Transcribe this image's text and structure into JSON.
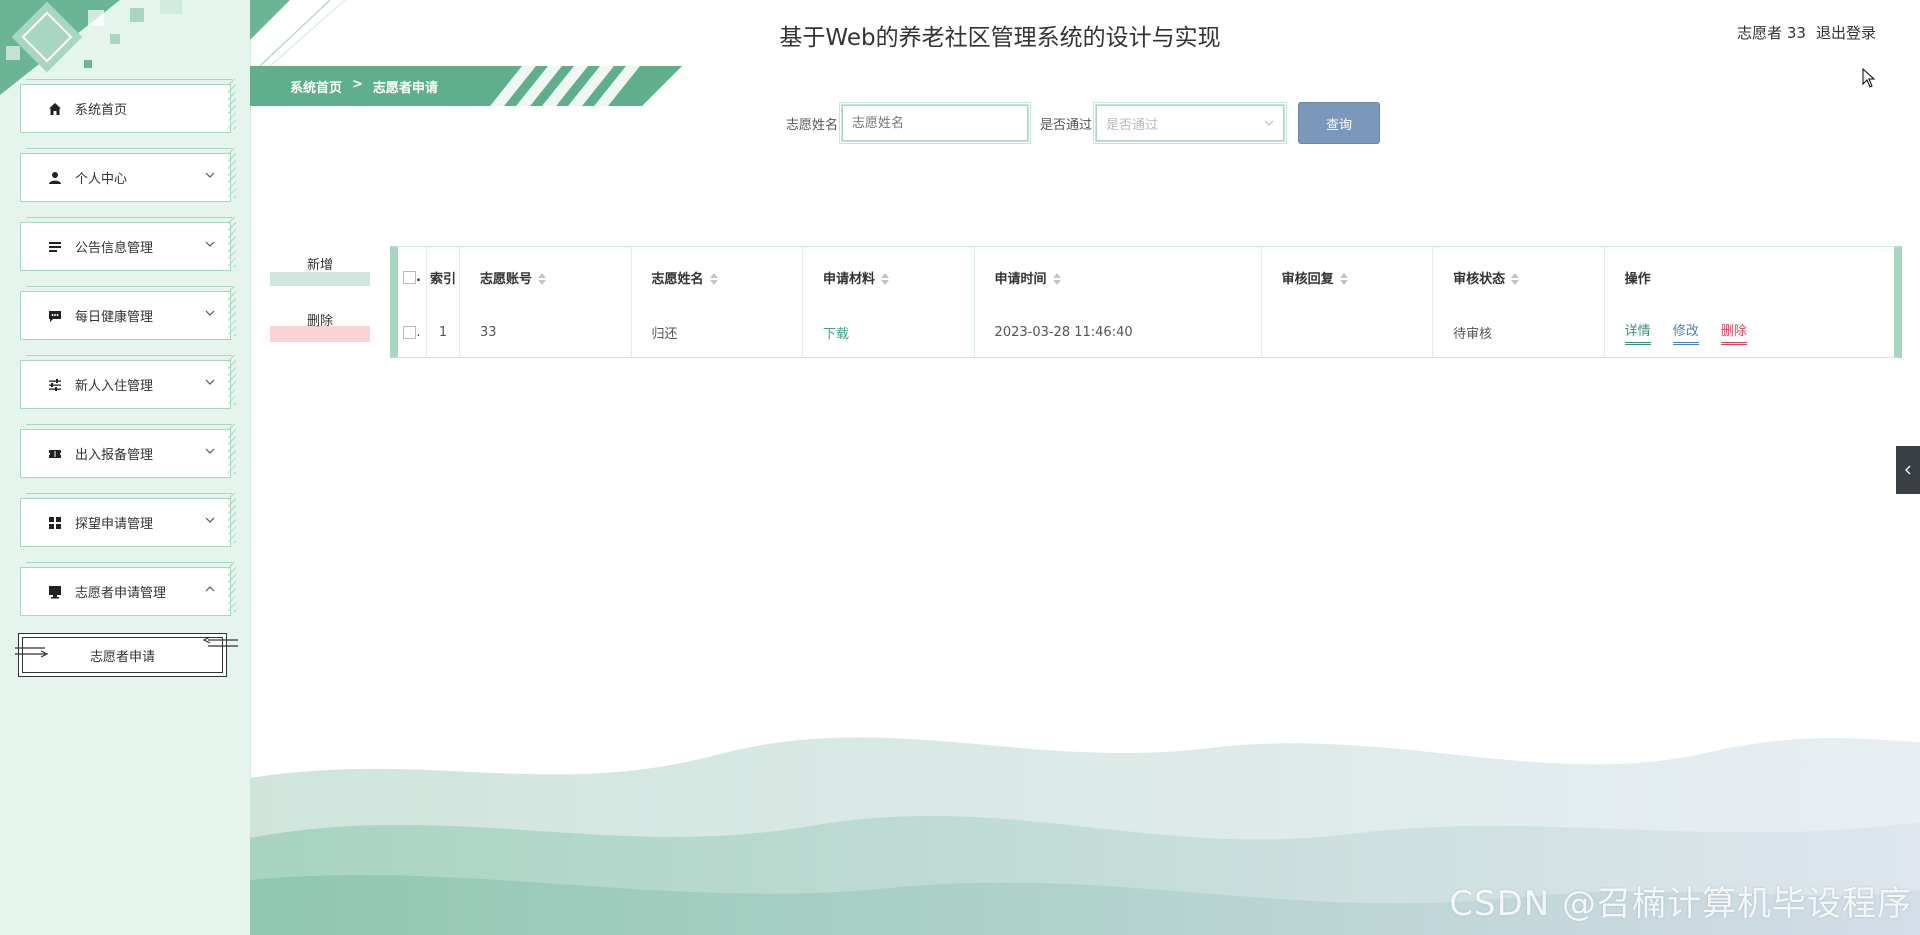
{
  "app": {
    "title": "基于Web的养老社区管理系统的设计与实现"
  },
  "user": {
    "name": "志愿者 33",
    "logout": "退出登录"
  },
  "breadcrumb": {
    "home": "系统首页",
    "separator": ">",
    "current": "志愿者申请"
  },
  "sidebar": {
    "items": [
      {
        "label": "系统首页",
        "icon": "home-icon"
      },
      {
        "label": "个人中心",
        "icon": "person-icon"
      },
      {
        "label": "公告信息管理",
        "icon": "list-icon"
      },
      {
        "label": "每日健康管理",
        "icon": "chat-icon"
      },
      {
        "label": "新人入住管理",
        "icon": "sliders-icon"
      },
      {
        "label": "出入报备管理",
        "icon": "ticket-icon"
      },
      {
        "label": "探望申请管理",
        "icon": "grid-icon"
      },
      {
        "label": "志愿者申请管理",
        "icon": "monitor-icon"
      }
    ],
    "subitem": "志愿者申请"
  },
  "search": {
    "name_label": "志愿姓名",
    "name_placeholder": "志愿姓名",
    "pass_label": "是否通过",
    "pass_placeholder": "是否通过",
    "query": "查询"
  },
  "actions": {
    "add": "新增",
    "delete": "删除"
  },
  "table": {
    "headers": {
      "index": "索引",
      "account": "志愿账号",
      "name": "志愿姓名",
      "material": "申请材料",
      "time": "申请时间",
      "reply": "审核回复",
      "status": "审核状态",
      "ops": "操作"
    },
    "rows": [
      {
        "index": "1",
        "account": "33",
        "name": "归还",
        "material": "下载",
        "time": "2023-03-28 11:46:40",
        "reply": "",
        "status": "待审核",
        "op_detail": "详情",
        "op_edit": "修改",
        "op_delete": "删除"
      }
    ]
  },
  "watermark": "CSDN @召楠计算机毕设程序",
  "colors": {
    "accent": "#5aae8e",
    "sidebar_bg": "#e6f4ee",
    "query_btn": "#7b98bb",
    "delete_red": "#d24a5f"
  }
}
